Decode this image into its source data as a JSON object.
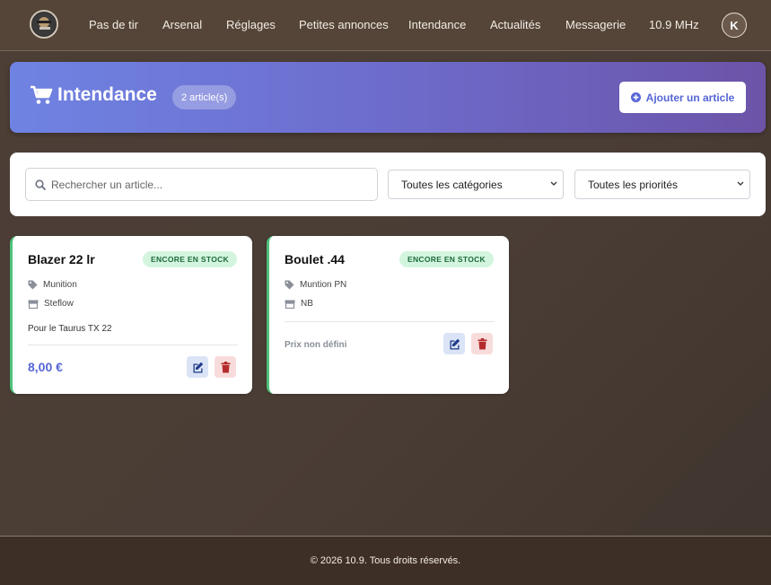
{
  "nav": {
    "items": [
      "Pas de tir",
      "Arsenal",
      "Réglages",
      "Petites annonces",
      "Intendance",
      "Actualités",
      "Messagerie",
      "10.9 MHz"
    ],
    "avatar_initial": "K"
  },
  "banner": {
    "title": "Intendance",
    "count_badge": "2 article(s)",
    "add_button_label": "Ajouter un article"
  },
  "filters": {
    "search_placeholder": "Rechercher un article...",
    "category_selected": "Toutes les catégories",
    "priority_selected": "Toutes les priorités"
  },
  "cards": [
    {
      "title": "Blazer 22 lr",
      "status": "ENCORE EN STOCK",
      "category": "Munition",
      "store": "Steflow",
      "note": "Pour le Taurus TX 22",
      "price": "8,00 €"
    },
    {
      "title": "Boulet .44",
      "status": "ENCORE EN STOCK",
      "category": "Muntion PN",
      "store": "NB",
      "price_undefined": "Prix non défini"
    }
  ],
  "footer": {
    "text": "© 2026 10.9. Tous droits réservés."
  },
  "colors": {
    "accent": "#5566d6",
    "stock_green": "#4fc07a",
    "delete_red": "#b52b2b"
  }
}
